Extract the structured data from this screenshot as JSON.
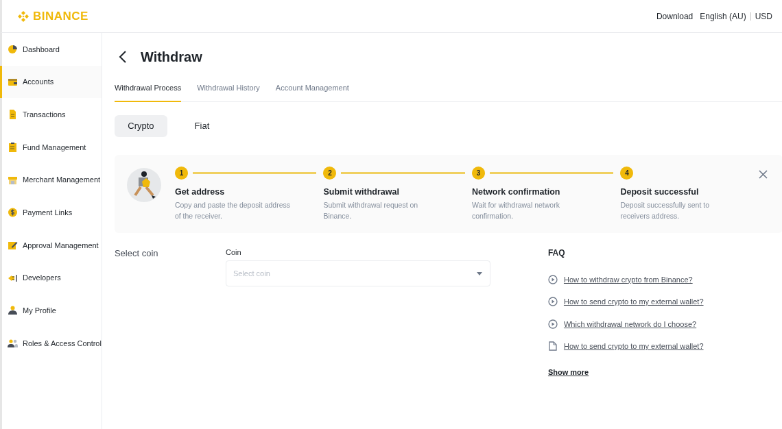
{
  "header": {
    "logo": "BINANCE",
    "links": [
      "Download",
      "English (AU)",
      "USD"
    ]
  },
  "sidebar": {
    "items": [
      {
        "label": "Dashboard",
        "selected": false
      },
      {
        "label": "Accounts",
        "selected": true
      },
      {
        "label": "Transactions",
        "selected": false
      },
      {
        "label": "Fund Management",
        "selected": false
      },
      {
        "label": "Merchant Management",
        "selected": false
      },
      {
        "label": "Payment Links",
        "selected": false
      },
      {
        "label": "Approval Management",
        "selected": false
      },
      {
        "label": "Developers",
        "selected": false
      },
      {
        "label": "My Profile",
        "selected": false
      },
      {
        "label": "Roles & Access Control",
        "selected": false
      }
    ]
  },
  "page": {
    "title": "Withdraw",
    "tabs": [
      {
        "label": "Withdrawal Process",
        "selected": true
      },
      {
        "label": "Withdrawal History",
        "selected": false
      },
      {
        "label": "Account Management",
        "selected": false
      }
    ],
    "segments": [
      {
        "label": "Crypto",
        "selected": true
      },
      {
        "label": "Fiat",
        "selected": false
      }
    ],
    "steps": [
      {
        "number": "1",
        "title": "Get address",
        "description": "Copy and paste the deposit address of the receiver."
      },
      {
        "number": "2",
        "title": "Submit withdrawal",
        "description": "Submit withdrawal request on Binance."
      },
      {
        "number": "3",
        "title": "Network confirmation",
        "description": "Wait for withdrawal network confirmation."
      },
      {
        "number": "4",
        "title": "Deposit successful",
        "description": "Deposit successfully sent to receivers address."
      }
    ],
    "form": {
      "section_label": "Select coin",
      "field_label": "Coin",
      "placeholder": "Select coin"
    },
    "faq": {
      "title": "FAQ",
      "items": [
        {
          "kind": "video",
          "label": "How to withdraw crypto from Binance?"
        },
        {
          "kind": "video",
          "label": "How to send crypto to my external wallet?"
        },
        {
          "kind": "video",
          "label": "Which withdrawal network do I choose?"
        },
        {
          "kind": "article",
          "label": "How to send crypto to my external wallet?"
        }
      ],
      "more": "Show more"
    }
  }
}
